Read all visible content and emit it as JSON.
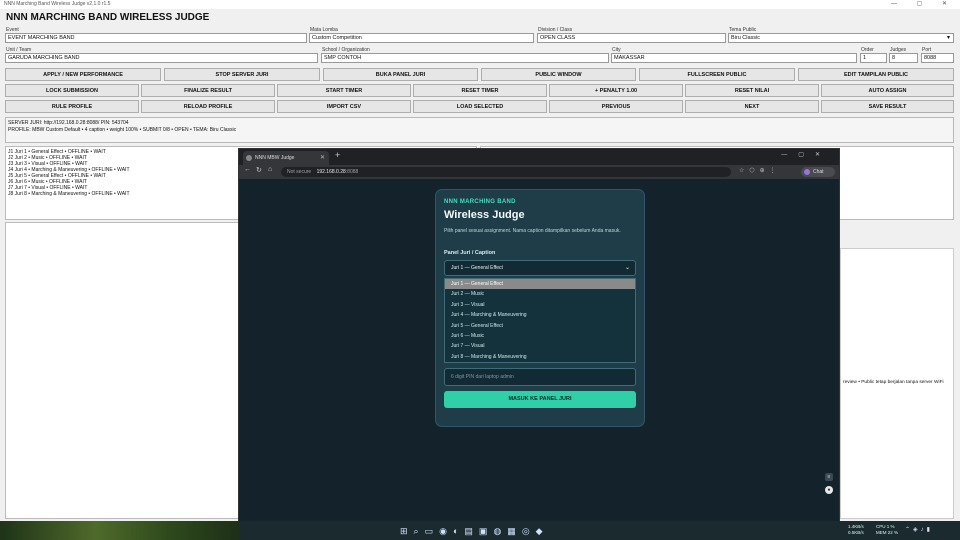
{
  "window": {
    "title": "NNN Marching Band Wireless Judge v2.1.0 r1.5",
    "controls": "—  ▢  ✕"
  },
  "app_title": "NNN MARCHING BAND WIRELESS JUDGE",
  "fields": {
    "event_label": "Event",
    "event_value": "EVENT MARCHING BAND",
    "mata_label": "Mata Lomba",
    "mata_value": "Custom Competition",
    "division_label": "Division / Class",
    "division_value": "OPEN CLASS",
    "tema_label": "Tema Public",
    "tema_value": "Biru Classic",
    "unit_label": "Unit / Team",
    "unit_value": "GARUDA MARCHING BAND",
    "school_label": "School / Organization",
    "school_value": "SMP CONTOH",
    "city_label": "City",
    "city_value": "MAKASSAR",
    "order_label": "Order",
    "order_value": "1",
    "judges_label": "Judges",
    "judges_value": "8",
    "port_label": "Port",
    "port_value": "8088"
  },
  "buttons_row1": [
    "APPLY / NEW PERFORMANCE",
    "STOP SERVER JURI",
    "BUKA PANEL JURI",
    "PUBLIC WINDOW",
    "FULLSCREEN PUBLIC",
    "EDIT TAMPILAN PUBLIC"
  ],
  "buttons_row2": [
    "LOCK SUBMISSION",
    "FINALIZE RESULT",
    "START TIMER",
    "RESET TIMER",
    "+ PENALTY 1.00",
    "RESET NILAI",
    "AUTO ASSIGN"
  ],
  "buttons_row3": [
    "RULE PROFILE",
    "RELOAD PROFILE",
    "IMPORT CSV",
    "LOAD SELECTED",
    "PREVIOUS",
    "NEXT",
    "SAVE RESULT"
  ],
  "status": {
    "line1": "SERVER JURI: http://192.168.0.28:8088/    PIN: 543704",
    "line2": "PROFILE: MBW Custom Default • 4 caption • weight 100%   •   SUBMIT 0/8   •   OPEN   •   TEMA: Biru Classic"
  },
  "juri_list": [
    "J1  Juri 1  •  General Effect  •  OFFLINE  •  WAIT",
    "J2  Juri 2  •  Music  •  OFFLINE  •  WAIT",
    "J3  Juri 3  •  Visual  •  OFFLINE  •  WAIT",
    "J4  Juri 4  •  Marching & Maneuvering  •  OFFLINE  •  WAIT",
    "J5  Juri 5  •  General Effect  •  OFFLINE  •  WAIT",
    "J6  Juri 6  •  Music  •  OFFLINE  •  WAIT",
    "J7  Juri 7  •  Visual  •  OFFLINE  •  WAIT",
    "J8  Juri 8  •  Marching & Maneuvering  •  OFFLINE  •  WAIT"
  ],
  "side_note": "review  •  Public tetap berjalan tanpa server WiFi",
  "browser": {
    "tab_title": "NNN MBW Judge",
    "security": "Not secure",
    "url_host": "192.168.0.28",
    "url_port": ":8088",
    "chat_label": "Chat"
  },
  "judge_card": {
    "brand": "NNN MARCHING BAND",
    "heading": "Wireless Judge",
    "description": "Pilih panel sesuai assignment. Nama caption ditampilkan sebelum Anda masuk.",
    "panel_label": "Panel Juri / Caption",
    "selected": "Juri 1 — General Effect",
    "options": [
      "Juri 1 — General Effect",
      "Juri 2 — Music",
      "Juri 3 — Visual",
      "Juri 4 — Marching & Maneuvering",
      "Juri 5 — General Effect",
      "Juri 6 — Music",
      "Juri 7 — Visual",
      "Juri 8 — Marching & Maneuvering"
    ],
    "pin_placeholder": "6 digit PIN dari laptop admin",
    "enter_button": "MASUK KE PANEL JURI"
  },
  "tray": {
    "net1": "1.4KB/s",
    "net2": "0.5KB/s",
    "cpu": "CPU 1 %",
    "mem": "MEM 22 %"
  },
  "icons": [
    "start-icon",
    "search-icon",
    "taskview-icon",
    "chrome-icon",
    "edge-icon",
    "folder-icon",
    "photos-icon",
    "app-icon",
    "excel-icon",
    "browser-icon",
    "python-icon"
  ]
}
